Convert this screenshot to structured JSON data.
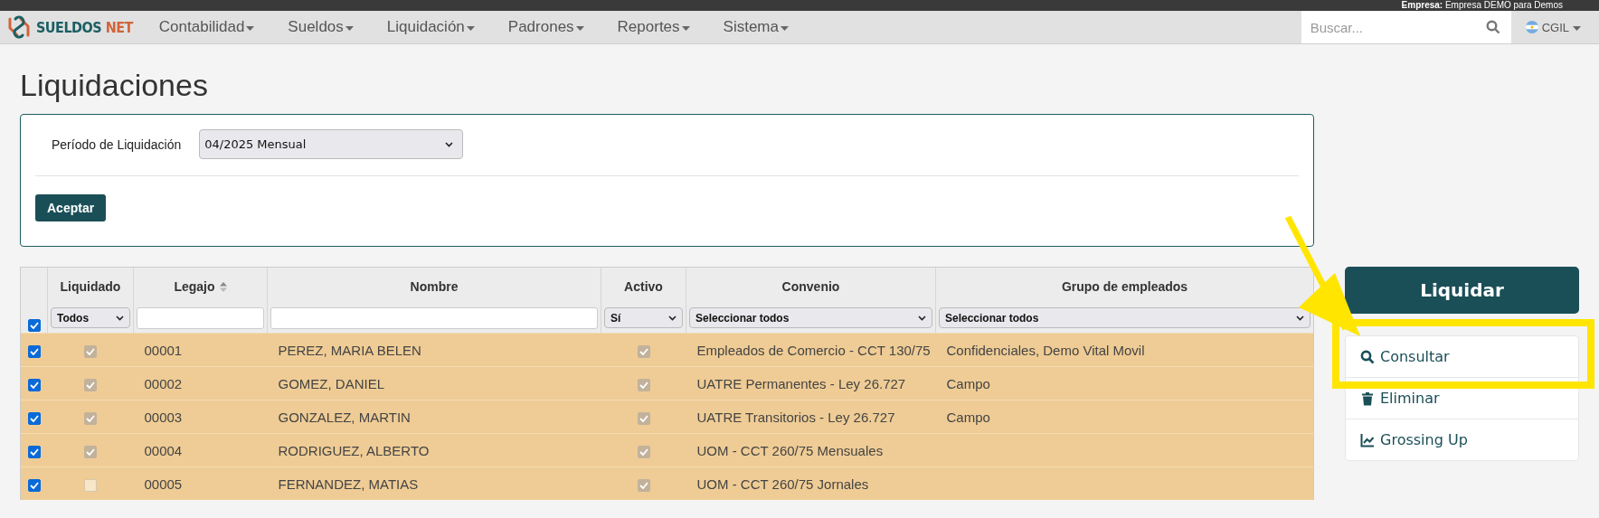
{
  "top_bar": {
    "label": "Empresa:",
    "value": "Empresa DEMO para Demos"
  },
  "navbar": {
    "brand": {
      "word1": "SUELDOS",
      "word2": "NET"
    },
    "menu": [
      {
        "label": "Contabilidad"
      },
      {
        "label": "Sueldos"
      },
      {
        "label": "Liquidación"
      },
      {
        "label": "Padrones"
      },
      {
        "label": "Reportes"
      },
      {
        "label": "Sistema"
      }
    ],
    "search": {
      "placeholder": "Buscar..."
    },
    "user": {
      "label": "CGIL"
    }
  },
  "page_title": "Liquidaciones",
  "filter": {
    "label": "Período de Liquidación",
    "period": "04/2025 Mensual",
    "accept": "Aceptar"
  },
  "table": {
    "select_all": {
      "checked": true
    },
    "columns": [
      {
        "label": "Liquidado",
        "kind": "select",
        "filter_value": "Todos"
      },
      {
        "label": "Legajo",
        "kind": "text",
        "sortable": true
      },
      {
        "label": "Nombre",
        "kind": "text"
      },
      {
        "label": "Activo",
        "kind": "select",
        "filter_value": "Sí"
      },
      {
        "label": "Convenio",
        "kind": "select",
        "filter_value": "Seleccionar todos"
      },
      {
        "label": "Grupo de empleados",
        "kind": "select",
        "filter_value": "Seleccionar todos"
      }
    ],
    "rows": [
      {
        "checked": true,
        "liquidado": true,
        "legajo": "00001",
        "nombre": "PEREZ, MARIA BELEN",
        "activo": true,
        "convenio": "Empleados de Comercio - CCT 130/75",
        "grupo": "Confidenciales, Demo Vital Movil"
      },
      {
        "checked": true,
        "liquidado": true,
        "legajo": "00002",
        "nombre": "GOMEZ, DANIEL",
        "activo": true,
        "convenio": "UATRE Permanentes - Ley 26.727",
        "grupo": "Campo"
      },
      {
        "checked": true,
        "liquidado": true,
        "legajo": "00003",
        "nombre": "GONZALEZ, MARTIN",
        "activo": true,
        "convenio": "UATRE Transitorios - Ley 26.727",
        "grupo": "Campo"
      },
      {
        "checked": true,
        "liquidado": true,
        "legajo": "00004",
        "nombre": "RODRIGUEZ, ALBERTO",
        "activo": true,
        "convenio": "UOM - CCT 260/75 Mensuales"
      },
      {
        "checked": true,
        "liquidado": false,
        "legajo": "00005",
        "nombre": "FERNANDEZ, MATIAS",
        "activo": true,
        "convenio": "UOM - CCT 260/75 Jornales"
      }
    ]
  },
  "actions": {
    "primary": "Liquidar",
    "items": [
      {
        "kind": "search",
        "label": "Consultar"
      },
      {
        "kind": "trash",
        "label": "Eliminar"
      },
      {
        "kind": "chart",
        "label": "Grossing Up"
      }
    ]
  }
}
